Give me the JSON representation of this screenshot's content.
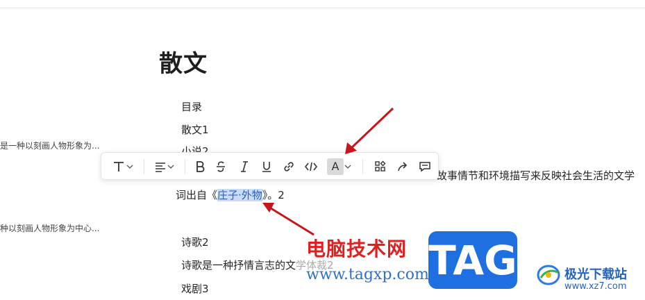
{
  "document": {
    "title": "散文",
    "lines": {
      "toc": "目录",
      "prose1": "散文1",
      "novel2": "小说2",
      "novel_desc_right": "故事情节和环境描写来反映社会生活的文学",
      "origin_prefix": "词出自《",
      "origin_selected": "庄子·外物",
      "origin_suffix": "》。2",
      "poetry2": "诗歌2",
      "poetry_desc_prefix": "诗歌是一种抒情言志的文",
      "poetry_desc_suffix": "学体裁2",
      "drama3": "戏剧3"
    },
    "side_snippets": [
      "是一种以刻画人物形象为...",
      "种以刻画人物形象为中心..."
    ]
  },
  "toolbar": {
    "buttons": [
      {
        "name": "text-style",
        "icon": "text-type-icon",
        "has_dropdown": true
      },
      {
        "name": "align",
        "icon": "align-left-icon",
        "has_dropdown": true
      },
      {
        "name": "bold",
        "icon": "bold-icon"
      },
      {
        "name": "strikethrough",
        "icon": "strikethrough-icon"
      },
      {
        "name": "italic",
        "icon": "italic-icon"
      },
      {
        "name": "underline",
        "icon": "underline-icon"
      },
      {
        "name": "link",
        "icon": "link-icon"
      },
      {
        "name": "code",
        "icon": "code-icon"
      },
      {
        "name": "font-color",
        "icon": "font-color-icon",
        "label": "A",
        "has_dropdown": true,
        "active": true
      },
      {
        "name": "more-blocks",
        "icon": "grid-icon"
      },
      {
        "name": "share",
        "icon": "share-icon"
      },
      {
        "name": "comment",
        "icon": "comment-icon"
      }
    ]
  },
  "watermark": {
    "site_name": "电脑技术网",
    "site_url": "www.tagxp.com",
    "badge": "TAG",
    "download_site_name": "极光下载站",
    "download_site_url": "www.xz7.com"
  },
  "colors": {
    "selection_bg": "#c9dcf7",
    "annotation_arrow": "#c8141a",
    "badge_blue": "#1e6fe0",
    "watermark_red": "#e02020"
  }
}
